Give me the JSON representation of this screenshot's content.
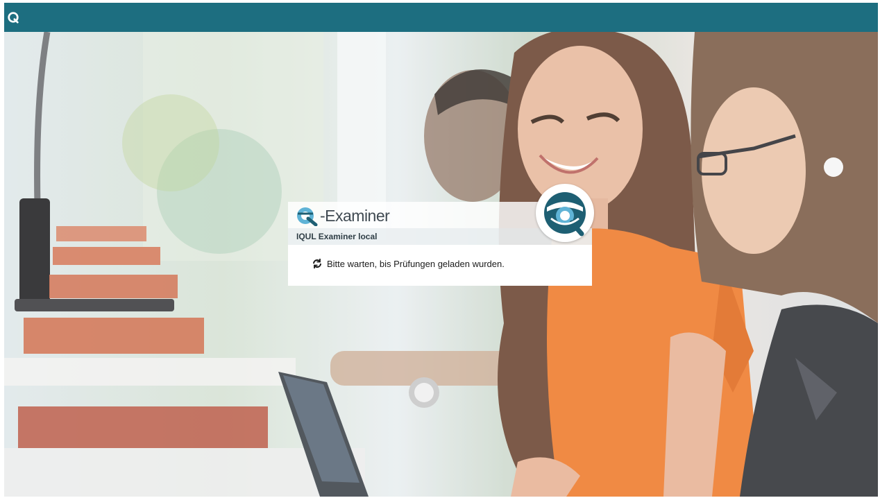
{
  "app": {
    "brand_suffix": "-Examiner",
    "instance_name": "IQUL Examiner local"
  },
  "dialog": {
    "status_message": "Bitte warten, bis Prüfungen geladen wurden.",
    "status_icon": "refresh-icon"
  },
  "icons": {
    "topbar": "iqul-logo-icon",
    "header": "iqul-q-logo-icon",
    "badge": "iqul-q-badge-icon"
  },
  "colors": {
    "topbar": "#1d6e80",
    "logo_dark": "#1e5f73",
    "logo_light": "#5fb3d6",
    "brand_text": "#404a52"
  }
}
